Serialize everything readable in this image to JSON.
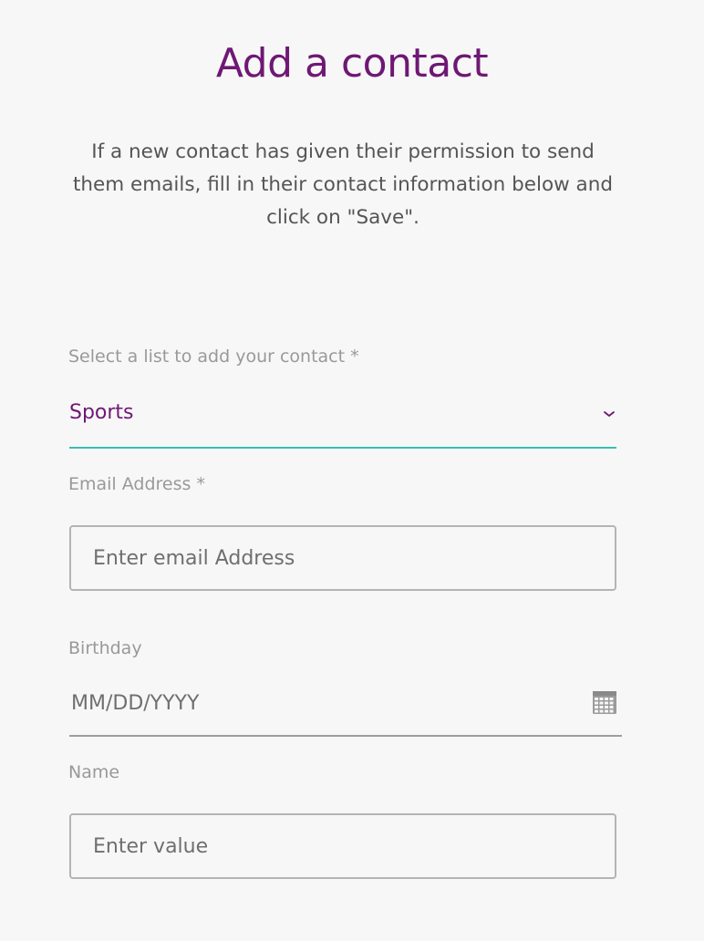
{
  "header": {
    "title": "Add a contact",
    "intro": "If a new contact has given their permission to send them emails, fill in their contact information below and click on \"Save\"."
  },
  "form": {
    "list": {
      "label": "Select a list to add your contact *",
      "selected": "Sports",
      "icon": "chevron-down-icon"
    },
    "email": {
      "label": "Email Address *",
      "placeholder": "Enter email Address",
      "value": ""
    },
    "birthday": {
      "label": "Birthday",
      "placeholder": "MM/DD/YYYY",
      "value": "",
      "icon": "calendar-icon"
    },
    "name": {
      "label": "Name",
      "placeholder": "Enter value",
      "value": ""
    }
  },
  "colors": {
    "brand": "#6e1874",
    "accent": "#3bbdb0",
    "label": "#999999",
    "text": "#555555"
  }
}
